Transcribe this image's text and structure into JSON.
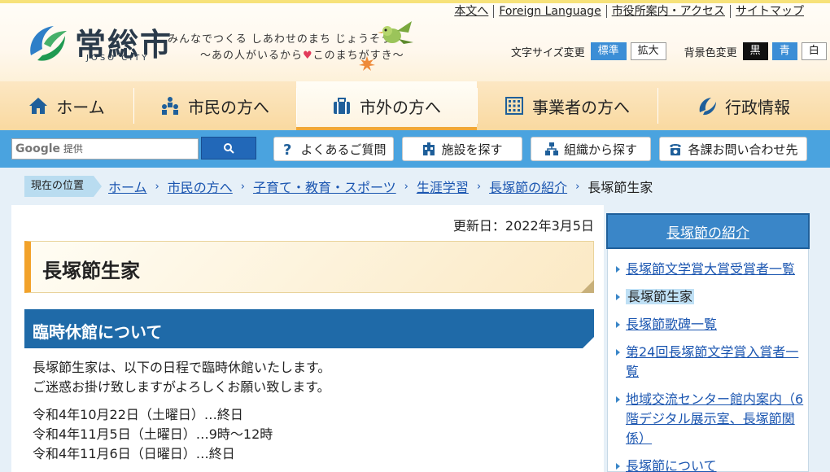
{
  "header": {
    "logo_name": "常総市",
    "logo_sub": "JOSO CITY",
    "slogan_line1": "みんなでつくる しあわせのまち じょうそう",
    "slogan_line2_a": "～あの人がいるから",
    "slogan_heart": "♥",
    "slogan_line2_b": "このまちがすき～",
    "util_links": [
      "本文へ",
      "Foreign Language",
      "市役所案内・アクセス",
      "サイトマップ"
    ],
    "font_size_label": "文字サイズ変更",
    "font_size_options": [
      "標準",
      "拡大"
    ],
    "bg_color_label": "背景色変更",
    "bg_color_options": [
      "黒",
      "青",
      "白"
    ]
  },
  "gnav": {
    "items": [
      "ホーム",
      "市民の方へ",
      "市外の方へ",
      "事業者の方へ",
      "行政情報"
    ]
  },
  "searchbar": {
    "placeholder_brand": "Google",
    "placeholder_suffix": "提供",
    "quick_links": [
      "よくあるご質問",
      "施設を探す",
      "組織から探す",
      "各課お問い合わせ先"
    ]
  },
  "breadcrumb": {
    "here_label": "現在の位置",
    "links": [
      "ホーム",
      "市民の方へ",
      "子育て・教育・スポーツ",
      "生涯学習",
      "長塚節の紹介"
    ],
    "current": "長塚節生家"
  },
  "main": {
    "updated": "更新日：2022年3月5日",
    "title": "長塚節生家",
    "section_title": "臨時休館について",
    "paragraph_lines": [
      "長塚節生家は、以下の日程で臨時休館いたします。",
      "ご迷惑お掛け致しますがよろしくお願い致します。"
    ],
    "schedule_lines": [
      "令和4年10月22日（土曜日）…終日",
      "令和4年11月5日（土曜日）…9時～12時",
      "令和4年11月6日（日曜日）…終日"
    ]
  },
  "sidebar": {
    "heading": "長塚節の紹介",
    "items": [
      {
        "label": "長塚節文学賞大賞受賞者一覧"
      },
      {
        "label": "長塚節生家"
      },
      {
        "label": "長塚節歌碑一覧"
      },
      {
        "label": "第24回長塚節文学賞入賞者一覧"
      },
      {
        "label": "地域交流センター館内案内（6階デジタル展示室、長塚節関係）"
      },
      {
        "label": "長塚節について"
      }
    ]
  },
  "colors": {
    "accent_blue": "#3b8ed6",
    "nav_orange": "#f0a838",
    "section_blue": "#1f6aa8",
    "link_blue": "#1a55b0"
  }
}
